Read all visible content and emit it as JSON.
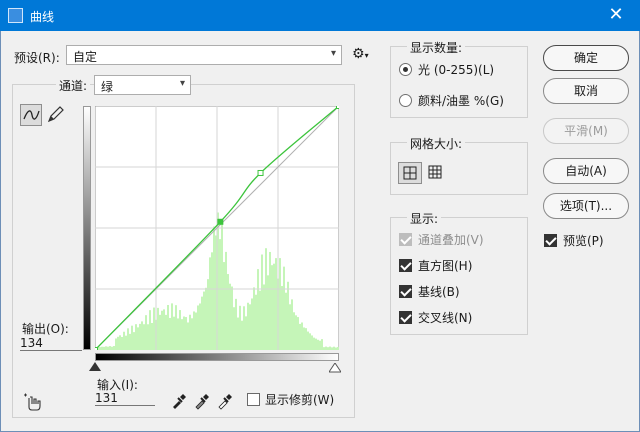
{
  "window": {
    "title": "曲线",
    "close_glyph": "✕"
  },
  "preset": {
    "label": "预设(R):",
    "value": "自定",
    "dropdown_icon": "chevron-down-icon",
    "settings_icon": "gear-icon"
  },
  "channel": {
    "label": "通道:",
    "value": "绿"
  },
  "curve": {
    "channel_color": "#3cc43c",
    "points": [
      [
        0,
        0
      ],
      [
        131,
        134
      ],
      [
        173,
        185
      ],
      [
        255,
        255
      ]
    ],
    "histogram_color": "#c5f5b8"
  },
  "output": {
    "label": "输出(O):",
    "value": "134"
  },
  "input": {
    "label": "输入(I):",
    "value": "131"
  },
  "clipping": {
    "label": "显示修剪(W)",
    "checked": false
  },
  "display_amount": {
    "title": "显示数量:",
    "options": [
      {
        "label": "光 (0-255)(L)",
        "selected": true
      },
      {
        "label": "颜料/油墨 %(G)",
        "selected": false
      }
    ]
  },
  "grid_size": {
    "title": "网格大小:"
  },
  "show": {
    "title": "显示:",
    "options": [
      {
        "label": "通道叠加(V)",
        "checked": true,
        "disabled": true
      },
      {
        "label": "直方图(H)",
        "checked": true,
        "disabled": false
      },
      {
        "label": "基线(B)",
        "checked": true,
        "disabled": false
      },
      {
        "label": "交叉线(N)",
        "checked": true,
        "disabled": false
      }
    ]
  },
  "buttons": {
    "ok": "确定",
    "cancel": "取消",
    "smooth": "平滑(M)",
    "auto": "自动(A)",
    "options": "选项(T)..."
  },
  "preview": {
    "label": "预览(P)",
    "checked": true
  }
}
